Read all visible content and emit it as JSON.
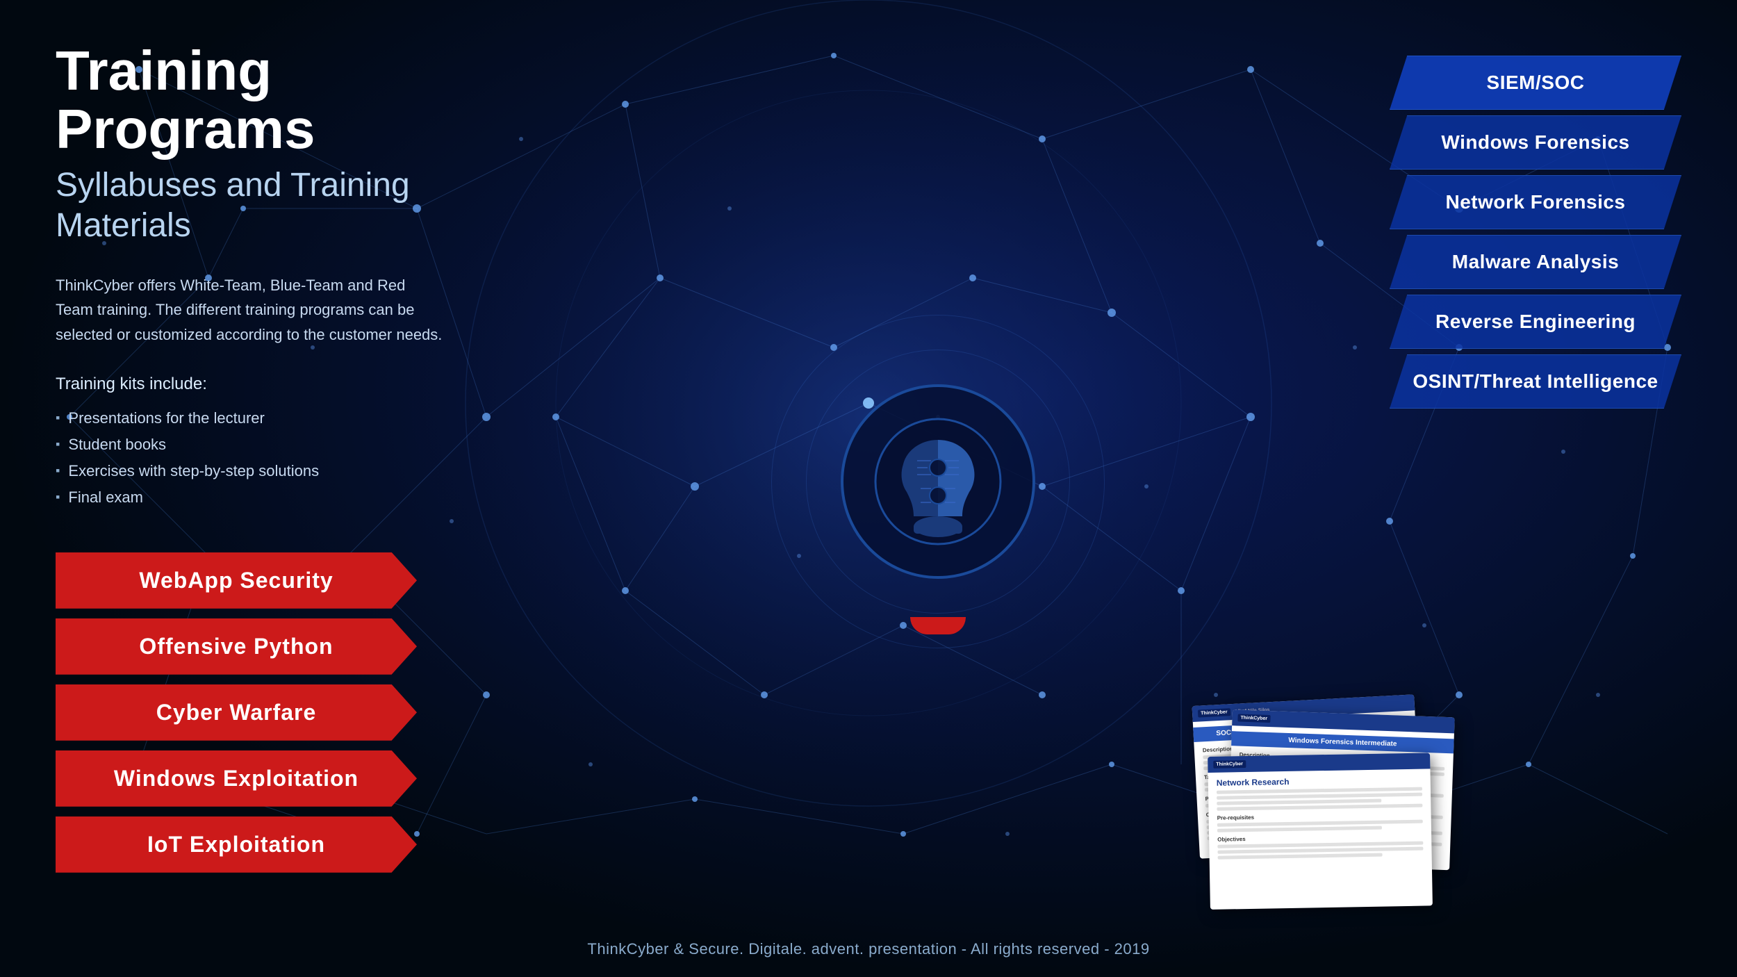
{
  "page": {
    "title": "Training Programs",
    "subtitle": "Syllabuses and Training Materials",
    "description": "ThinkCyber offers White-Team, Blue-Team and Red Team training. The different training programs can be selected or customized according to the customer needs.",
    "training_kits_title": "Training kits include:",
    "training_kits": [
      "Presentations for the lecturer",
      "Student books",
      "Exercises with step-by-step solutions",
      "Final exam"
    ]
  },
  "left_buttons": [
    {
      "label": "WebApp Security",
      "id": "webapp-security"
    },
    {
      "label": "Offensive Python",
      "id": "offensive-python"
    },
    {
      "label": "Cyber Warfare",
      "id": "cyber-warfare"
    },
    {
      "label": "Windows Exploitation",
      "id": "windows-exploitation"
    },
    {
      "label": "IoT Exploitation",
      "id": "iot-exploitation"
    }
  ],
  "right_buttons": [
    {
      "label": "SIEM/SOC",
      "id": "siem-soc"
    },
    {
      "label": "Windows Forensics",
      "id": "windows-forensics"
    },
    {
      "label": "Network Forensics",
      "id": "network-forensics"
    },
    {
      "label": "Malware Analysis",
      "id": "malware-analysis"
    },
    {
      "label": "Reverse Engineering",
      "id": "reverse-engineering"
    },
    {
      "label": "OSINT/Threat Intelligence",
      "id": "osint-threat-intelligence"
    }
  ],
  "documents": [
    {
      "title": "SOC Operation and Incident Response Fundamentals",
      "logo": "ThinkCyber"
    },
    {
      "title": "Windows Forensics Intermediate",
      "logo": "ThinkCyber"
    },
    {
      "title": "Network Research",
      "logo": "ThinkCyber"
    }
  ],
  "footer": {
    "text": "ThinkCyber & Secure. Digitale. advent. presentation - All rights reserved - 2019"
  },
  "colors": {
    "background": "#020c2e",
    "red_button": "#cc1a1a",
    "blue_button": "rgba(10, 50, 160, 0.85)",
    "accent_blue": "#1a4a9a",
    "text_primary": "#ffffff",
    "text_secondary": "#c8daf0"
  }
}
